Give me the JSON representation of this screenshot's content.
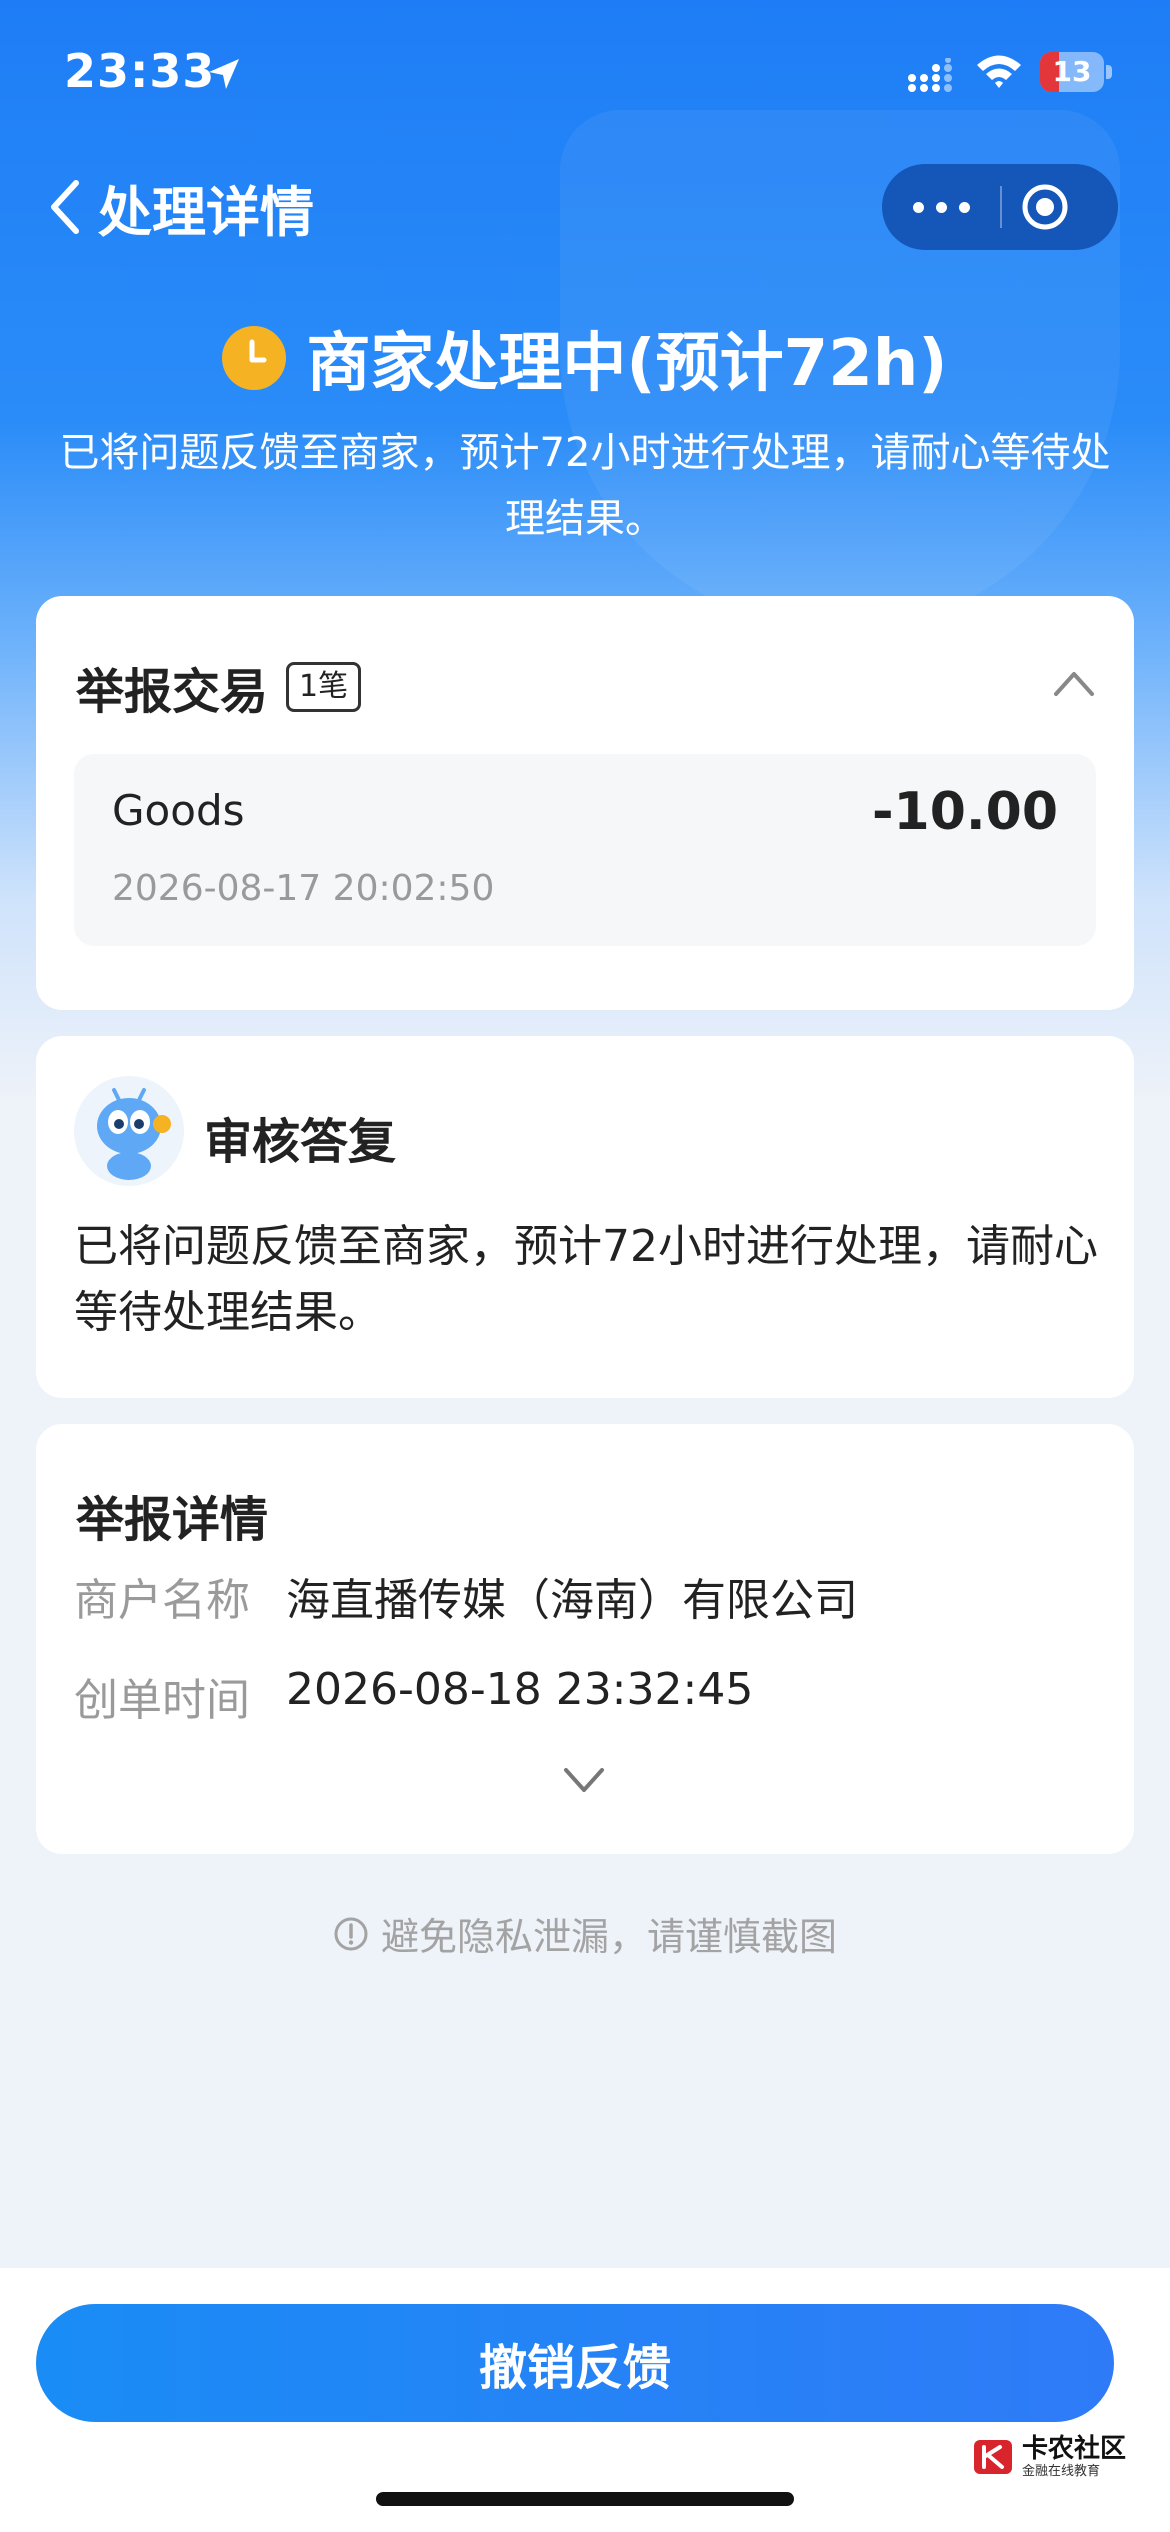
{
  "status_bar": {
    "time": "23:33",
    "battery": "13",
    "battery_level": 0.13
  },
  "nav": {
    "back_label": "处理详情"
  },
  "status": {
    "title": "商家处理中(预计72h)",
    "description": "已将问题反馈至商家，预计72小时进行处理，请耐心等待处理结果。"
  },
  "report_transaction": {
    "title": "举报交易",
    "count_badge": "1笔",
    "item": {
      "name": "Goods",
      "amount": "-10.00",
      "time": "2026-08-17 20:02:50"
    }
  },
  "review_reply": {
    "title": "审核答复",
    "body": "已将问题反馈至商家，预计72小时进行处理，请耐心等待处理结果。"
  },
  "report_details": {
    "title": "举报详情",
    "rows": [
      {
        "label": "商户名称",
        "value": "海直播传媒（海南）有限公司"
      },
      {
        "label": "创单时间",
        "value": "2026-08-18 23:32:45"
      }
    ]
  },
  "notice": "避免隐私泄漏，请谨慎截图",
  "action": {
    "revoke_label": "撤销反馈"
  },
  "watermark": {
    "main": "卡农社区",
    "sub": "金融在线教育"
  },
  "colors": {
    "brand_blue": "#1e7df6",
    "status_yellow": "#f5b324",
    "battery_low": "#e3363a"
  },
  "icons": [
    "location-arrow-icon",
    "signal-icon",
    "wifi-icon",
    "back-chevron-icon",
    "more-icon",
    "target-icon",
    "clock-icon",
    "chevron-up-icon",
    "chevron-down-icon",
    "info-icon"
  ]
}
